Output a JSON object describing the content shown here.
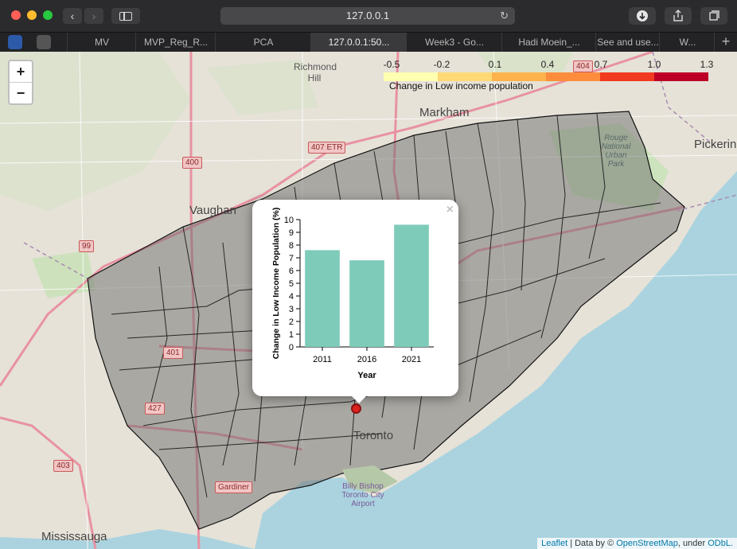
{
  "browser": {
    "url": "127.0.0.1",
    "tabs": [
      {
        "label": "MV"
      },
      {
        "label": "MVP_Reg_R..."
      },
      {
        "label": "PCA"
      },
      {
        "label": "127.0.0.1:50..."
      },
      {
        "label": "Week3 - Go..."
      },
      {
        "label": "Hadi Moein_..."
      },
      {
        "label": "See and use..."
      },
      {
        "label": "W..."
      }
    ],
    "new_tab_label": "+"
  },
  "map": {
    "zoom_in_label": "+",
    "zoom_out_label": "−",
    "place_labels": {
      "richmond_hill": "Richmond Hill",
      "markham": "Markham",
      "pickering": "Pickerin",
      "vaughan": "Vaughan",
      "toronto": "Toronto",
      "mississauga": "Mississauga",
      "rouge_park": "Rouge National Urban Park",
      "billy_bishop": "Billy Bishop Toronto City Airport",
      "gardiner": "Gardiner",
      "etr_407": "407 ETR"
    },
    "highway_shields": [
      "400",
      "407 ETR",
      "99",
      "403",
      "427",
      "401",
      "404"
    ],
    "legend": {
      "ticks": [
        "-0.5",
        "-0.2",
        "0.1",
        "0.4",
        "0.7",
        "1.0",
        "1.3"
      ],
      "colors": [
        "#ffffb2",
        "#fed976",
        "#feb24c",
        "#fd8d3c",
        "#f03b20",
        "#bd0026"
      ],
      "title": "Change in Low income population"
    },
    "attribution": {
      "leaflet": "Leaflet",
      "data_by": "| Data by ©",
      "osm": "OpenStreetMap",
      "under": ", under",
      "odbl": "ODbL."
    }
  },
  "popup": {
    "close_label": "×"
  },
  "chart_data": {
    "type": "bar",
    "categories": [
      "2011",
      "2016",
      "2021"
    ],
    "values": [
      7.6,
      6.8,
      9.6
    ],
    "xlabel": "Year",
    "ylabel": "Change in Low Income Population (%)",
    "ylim": [
      0,
      10
    ],
    "yticks": [
      "0",
      "1",
      "2",
      "3",
      "4",
      "5",
      "6",
      "7",
      "8",
      "9",
      "10"
    ],
    "bar_color": "#7ecbb9",
    "grid": false
  }
}
